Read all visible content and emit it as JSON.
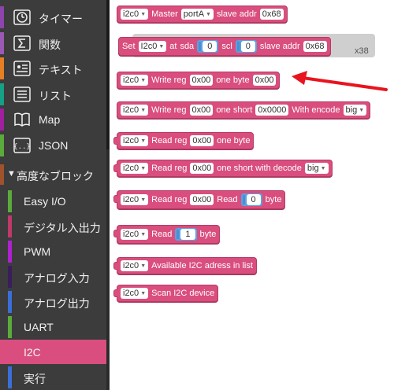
{
  "sidebar": {
    "categories": [
      {
        "label": "タイマー",
        "icon": "timer-icon",
        "color": "#8e44ad"
      },
      {
        "label": "関数",
        "icon": "sigma-icon",
        "color": "#9b59b6"
      },
      {
        "label": "テキスト",
        "icon": "text-icon",
        "color": "#e67e22"
      },
      {
        "label": "リスト",
        "icon": "list-icon",
        "color": "#16a085"
      },
      {
        "label": "Map",
        "icon": "book-icon",
        "color": "#a020a0"
      },
      {
        "label": "JSON",
        "icon": "json-icon",
        "color": "#5aaa3c"
      }
    ],
    "advanced_header": "高度なブロック",
    "subcategories": [
      {
        "label": "Easy I/O",
        "color": "#5aaa3c"
      },
      {
        "label": "デジタル入出力",
        "color": "#c0396b"
      },
      {
        "label": "PWM",
        "color": "#b020d0"
      },
      {
        "label": "アナログ入力",
        "color": "#3a1e5c"
      },
      {
        "label": "アナログ出力",
        "color": "#3a6fd8"
      },
      {
        "label": "UART",
        "color": "#5aaa3c"
      },
      {
        "label": "I2C",
        "color": "#d94e7e",
        "selected": true
      },
      {
        "label": "実行",
        "color": "#3a6fd8"
      }
    ]
  },
  "blocks": {
    "b1": {
      "dd": "i2c0",
      "t1": "Master",
      "dd2": "portA",
      "t2": "slave addr",
      "f1": "0x68"
    },
    "b2": {
      "t0": "Set",
      "dd": "I2c0",
      "t1": "at",
      "t2": "sda",
      "n1": "0",
      "t3": "scl",
      "n2": "0",
      "t4": "slave addr",
      "f1": "0x68"
    },
    "b3": {
      "dd": "i2c0",
      "t1": "Write reg",
      "f1": "0x00",
      "t2": "one byte",
      "f2": "0x00"
    },
    "b4": {
      "dd": "i2c0",
      "t1": "Write reg",
      "f1": "0x00",
      "t2": "one short",
      "f2": "0x0000",
      "t3": "With encode",
      "dd2": "big"
    },
    "b5": {
      "dd": "i2c0",
      "t1": "Read reg",
      "f1": "0x00",
      "t2": "one byte"
    },
    "b6": {
      "dd": "i2c0",
      "t1": "Read reg",
      "f1": "0x00",
      "t2": "one short with decode",
      "dd2": "big"
    },
    "b7": {
      "dd": "i2c0",
      "t1": "Read reg",
      "f1": "0x00",
      "t2": "Read",
      "n1": "0",
      "t3": "byte"
    },
    "b8": {
      "dd": "i2c0",
      "t1": "Read",
      "n1": "1",
      "t2": "byte"
    },
    "b9": {
      "dd": "i2c0",
      "t1": "Available I2C adress in list"
    },
    "b10": {
      "dd": "i2c0",
      "t1": "Scan I2C device"
    }
  },
  "ghost_text": "x38",
  "colors": {
    "block": "#d94e7e",
    "arrow": "#e8141e",
    "sidebar": "#3c3c3c"
  }
}
